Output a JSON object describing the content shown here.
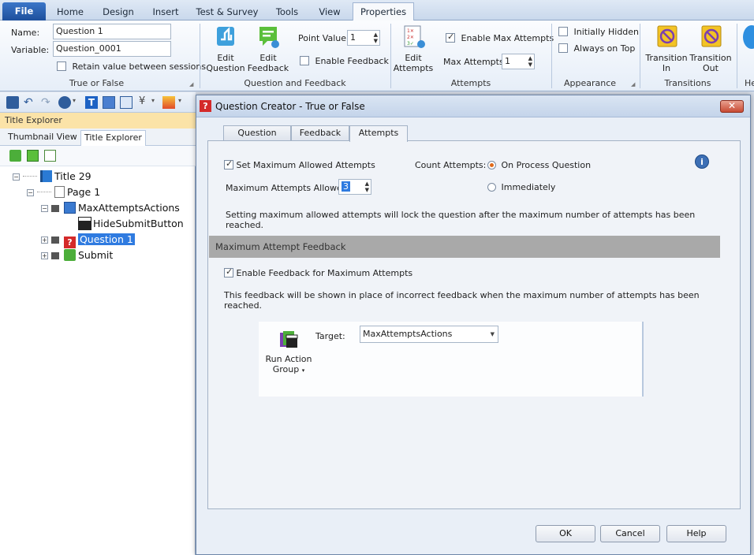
{
  "ribbon_tabs": [
    "File",
    "Home",
    "Design",
    "Insert",
    "Test & Survey",
    "Tools",
    "View",
    "Properties"
  ],
  "true_false_group": {
    "name_label": "Name:",
    "name_value": "Question 1",
    "variable_label": "Variable:",
    "variable_value": "Question_0001",
    "retain_label": "Retain value between sessions",
    "group_label": "True or False"
  },
  "question_feedback_group": {
    "edit_question": [
      "Edit",
      "Question"
    ],
    "edit_feedback": [
      "Edit",
      "Feedback"
    ],
    "point_value_label": "Point Value:",
    "point_value": "1",
    "enable_feedback_label": "Enable Feedback",
    "group_label": "Question and Feedback"
  },
  "attempts_group": {
    "edit_attempts": [
      "Edit",
      "Attempts"
    ],
    "enable_max_label": "Enable Max Attempts",
    "max_attempts_label": "Max Attempts:",
    "max_attempts_value": "1",
    "group_label": "Attempts"
  },
  "appearance_group": {
    "initially_hidden": "Initially Hidden",
    "always_on_top": "Always on Top",
    "group_label": "Appearance"
  },
  "transitions_group": {
    "transition_in": [
      "Transition",
      "In"
    ],
    "transition_out": [
      "Transition",
      "Out"
    ],
    "group_label": "Transitions",
    "overflow_label": "He"
  },
  "left_panel": {
    "header": "Title Explorer",
    "tabs": [
      "Thumbnail View",
      "Title Explorer"
    ],
    "tree": [
      {
        "label": "Title 29",
        "level": 0,
        "exp": "−",
        "icon": "title-book-icon"
      },
      {
        "label": "Page 1",
        "level": 1,
        "exp": "−",
        "icon": "page-icon"
      },
      {
        "label": "MaxAttemptsActions",
        "level": 2,
        "exp": "−",
        "icon": "action-group-icon"
      },
      {
        "label": "HideSubmitButton",
        "level": 3,
        "exp": "",
        "icon": "clapper-icon"
      },
      {
        "label": "Question 1",
        "level": 2,
        "exp": "+",
        "icon": "question-icon",
        "selected": true
      },
      {
        "label": "Submit",
        "level": 2,
        "exp": "+",
        "icon": "button-icon"
      }
    ]
  },
  "dialog": {
    "title": "Question Creator - True or False",
    "close_glyph": "✕",
    "tabs": [
      "Question",
      "Feedback",
      "Attempts"
    ],
    "set_max_label": "Set Maximum Allowed Attempts",
    "count_attempts_label": "Count Attempts:",
    "on_process_label": "On Process Question",
    "immediately_label": "Immediately",
    "max_allowed_label": "Maximum Attempts Allowed:",
    "max_allowed_value": "3",
    "lock_note": "Setting maximum allowed attempts will lock the question after the maximum number of attempts has been reached.",
    "section_header": "Maximum Attempt Feedback",
    "enable_feedback_max_label": "Enable Feedback for Maximum Attempts",
    "feedback_note": "This feedback will be shown in place of incorrect feedback when the maximum number of attempts has been reached.",
    "run_action_label": [
      "Run Action",
      "Group"
    ],
    "target_label": "Target:",
    "target_value": "MaxAttemptsActions",
    "ok_label": "OK",
    "cancel_label": "Cancel",
    "help_label": "Help"
  },
  "colors": {
    "accent": "#1d4f9c",
    "selected_tree": "#2f7be0",
    "section_header": "#a9a9a9",
    "radio_dot": "#e06a1b"
  }
}
